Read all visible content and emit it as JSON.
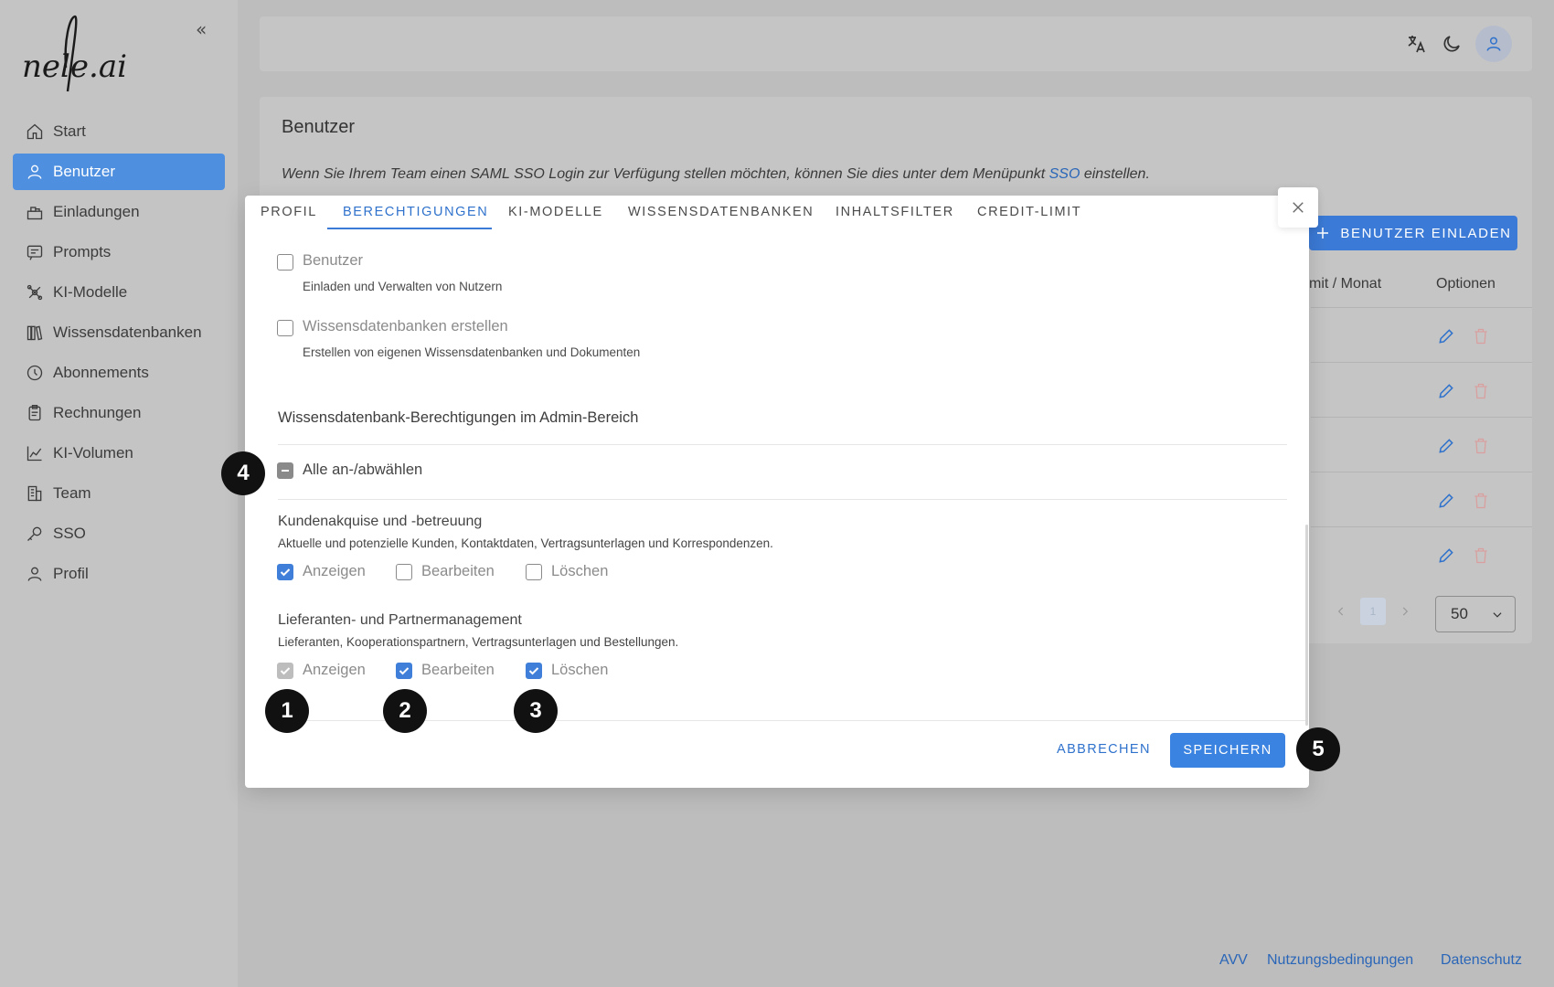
{
  "sidebar": {
    "logo_text": "nele.ai",
    "collapse_glyph": "«",
    "items": [
      {
        "label": "Start",
        "icon": "home-icon"
      },
      {
        "label": "Benutzer",
        "icon": "user-icon",
        "active": true
      },
      {
        "label": "Einladungen",
        "icon": "invite-icon"
      },
      {
        "label": "Prompts",
        "icon": "prompt-icon"
      },
      {
        "label": "KI-Modelle",
        "icon": "ai-model-icon"
      },
      {
        "label": "Wissensdatenbanken",
        "icon": "books-icon"
      },
      {
        "label": "Abonnements",
        "icon": "clock-icon"
      },
      {
        "label": "Rechnungen",
        "icon": "clipboard-icon"
      },
      {
        "label": "KI-Volumen",
        "icon": "chart-icon"
      },
      {
        "label": "Team",
        "icon": "building-icon"
      },
      {
        "label": "SSO",
        "icon": "key-icon"
      },
      {
        "label": "Profil",
        "icon": "profile-icon"
      }
    ]
  },
  "header": {
    "icons": [
      "translate-icon",
      "moon-icon",
      "avatar-icon"
    ]
  },
  "page": {
    "title": "Benutzer",
    "note_before": "Wenn Sie Ihrem Team einen SAML SSO Login zur Verfügung stellen möchten, können Sie dies unter dem Menüpunkt ",
    "note_link": "SSO",
    "note_after": " einstellen.",
    "invite_button": "BENUTZER EINLADEN",
    "col_limit": "mit / Monat",
    "col_options": "Optionen",
    "page_size": "50",
    "current_page": "1"
  },
  "footer": {
    "links": [
      "AVV",
      "Nutzungsbedingungen",
      "Datenschutz"
    ]
  },
  "modal": {
    "tabs": [
      "PROFIL",
      "BERECHTIGUNGEN",
      "KI-MODELLE",
      "WISSENSDATENBANKEN",
      "INHALTSFILTER",
      "CREDIT-LIMIT"
    ],
    "active_tab": "BERECHTIGUNGEN",
    "perm_benutzer": {
      "label": "Benutzer",
      "desc": "Einladen und Verwalten von Nutzern",
      "checked": false
    },
    "perm_wdb": {
      "label": "Wissensdatenbanken erstellen",
      "desc": "Erstellen von eigenen Wissensdatenbanken und Dokumenten",
      "checked": false
    },
    "admin_section_title": "Wissensdatenbank-Berechtigungen im Admin-Bereich",
    "select_all_label": "Alle an-/abwählen",
    "groups": [
      {
        "title": "Kundenakquise und -betreuung",
        "desc": "Aktuelle und potenzielle Kunden, Kontaktdaten, Vertragsunterlagen und Korrespondenzen.",
        "options": [
          {
            "label": "Anzeigen",
            "state": "checked"
          },
          {
            "label": "Bearbeiten",
            "state": "unchecked"
          },
          {
            "label": "Löschen",
            "state": "unchecked"
          }
        ]
      },
      {
        "title": "Lieferanten- und Partnermanagement",
        "desc": "Lieferanten, Kooperationspartnern, Vertragsunterlagen und Bestellungen.",
        "options": [
          {
            "label": "Anzeigen",
            "state": "disabled-checked"
          },
          {
            "label": "Bearbeiten",
            "state": "checked"
          },
          {
            "label": "Löschen",
            "state": "checked"
          }
        ]
      }
    ],
    "cancel_label": "ABBRECHEN",
    "save_label": "SPEICHERN"
  },
  "callouts": [
    "1",
    "2",
    "3",
    "4",
    "5"
  ]
}
